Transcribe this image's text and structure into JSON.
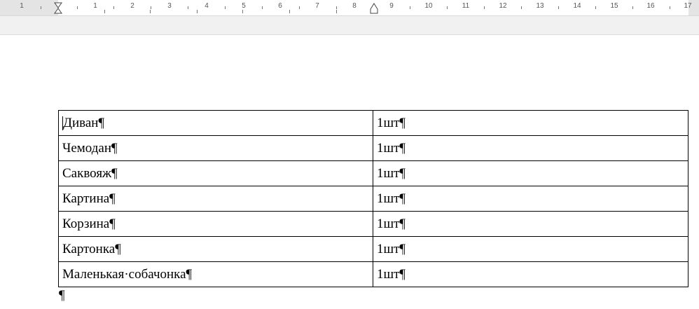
{
  "ruler": {
    "numbers": [
      "1",
      "1",
      "2",
      "3",
      "4",
      "5",
      "6",
      "7",
      "8",
      "9",
      "10",
      "11",
      "12",
      "13",
      "14",
      "15",
      "16",
      "17"
    ]
  },
  "table": {
    "rows": [
      {
        "item": "Диван¶",
        "qty": "1шт¶"
      },
      {
        "item": "Чемодан¶",
        "qty": "1шт¶"
      },
      {
        "item": "Саквояж¶",
        "qty": "1шт¶"
      },
      {
        "item": "Картина¶",
        "qty": "1шт¶"
      },
      {
        "item": "Корзина¶",
        "qty": "1шт¶"
      },
      {
        "item": "Картонка¶",
        "qty": "1шт¶"
      },
      {
        "item": "Маленькая·собачонка¶",
        "qty": "1шт¶"
      }
    ]
  },
  "trailing_paragraph": "¶"
}
